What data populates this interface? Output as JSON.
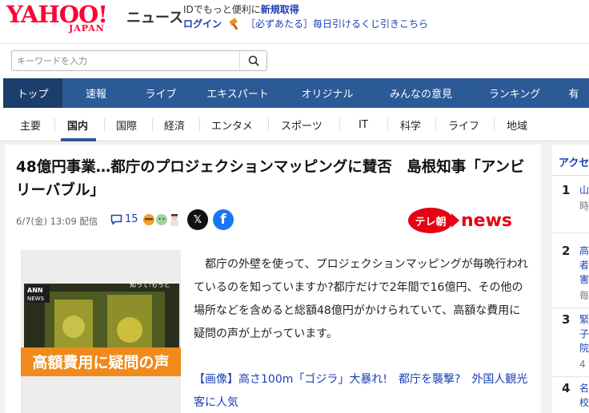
{
  "header": {
    "logo_main": "YAHOO!",
    "logo_sub": "JAPAN",
    "service_name": "ニュース",
    "id_prompt": "IDでもっと便利に",
    "signup": "新規取得",
    "login": "ログイン",
    "promo": "［必ずあたる］毎日引けるくじ引きこちら",
    "promo_icon": "hammer-icon"
  },
  "search": {
    "placeholder": "キーワードを入力",
    "value": "",
    "icon": "search-icon"
  },
  "nav": {
    "items": [
      {
        "label": "トップ",
        "active": true
      },
      {
        "label": "速報",
        "active": false
      },
      {
        "label": "ライブ",
        "active": false
      },
      {
        "label": "エキスパート",
        "active": false
      },
      {
        "label": "オリジナル",
        "active": false
      },
      {
        "label": "みんなの意見",
        "active": false
      },
      {
        "label": "ランキング",
        "active": false
      },
      {
        "label": "有",
        "active": false
      }
    ]
  },
  "subnav": {
    "items": [
      {
        "label": "主要",
        "active": false
      },
      {
        "label": "国内",
        "active": true
      },
      {
        "label": "国際",
        "active": false
      },
      {
        "label": "経済",
        "active": false
      },
      {
        "label": "エンタメ",
        "active": false
      },
      {
        "label": "スポーツ",
        "active": false
      },
      {
        "label": "IT",
        "active": false
      },
      {
        "label": "科学",
        "active": false
      },
      {
        "label": "ライフ",
        "active": false
      },
      {
        "label": "地域",
        "active": false
      }
    ]
  },
  "article": {
    "title": "48億円事業…都庁のプロジェクションマッピングに賛否　島根知事「アンビリーバブル」",
    "date": "6/7(金) 13:09 配信",
    "comment_count": "15",
    "source_badge": "テレ朝",
    "source_word": "news",
    "thumbnail": {
      "label_top": "ANN",
      "label_bottom": "NEWS",
      "tag": "知って!もっと",
      "caption": "高額費用に疑問の声"
    },
    "body": "都庁の外壁を使って、プロジェクションマッピングが毎晩行われているのを知っていますか?都庁だけで2年間で16億円、その他の場所などを含めると総額48億円がかけられていて、高額な費用に疑問の声が上がっています。",
    "image_link": "【画像】高さ100m「ゴジラ」大暴れ!　都庁を襲撃?　外国人観光客に人気"
  },
  "sidebar": {
    "heading": "アクセ",
    "items": [
      {
        "rank": "1",
        "line1": "山",
        "line2": "時",
        "line3": ""
      },
      {
        "rank": "2",
        "line1": "高",
        "line2": "者",
        "line3": "害",
        "line4": "毎"
      },
      {
        "rank": "3",
        "line1": "緊",
        "line2": "子",
        "line3": "院",
        "line4": "4"
      },
      {
        "rank": "4",
        "line1": "名",
        "line2": "校",
        "line3": ""
      }
    ]
  },
  "colors": {
    "brand_red": "#ff0033",
    "nav_blue": "#2b5a96",
    "nav_active": "#1c3e6c",
    "link_blue": "#1a3fb5",
    "source_red": "#e60012"
  }
}
